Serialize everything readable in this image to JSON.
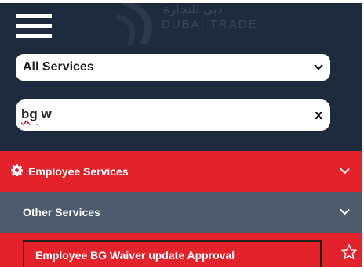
{
  "header": {
    "menu_icon": "hamburger-menu-icon",
    "logo_arabic": "دبي للتجارة",
    "logo_text": "DUBAI TRADE"
  },
  "filters": {
    "category_select": {
      "selected": "All Services",
      "icon": "chevron-down-icon"
    },
    "search": {
      "value_word1": "bg",
      "value_word2": " w",
      "clear_label": "x"
    }
  },
  "menu": {
    "employee_services": {
      "label": "Employee Services",
      "icon": "gear-icon",
      "expand_icon": "chevron-down-icon"
    },
    "other_services": {
      "label": "Other Services",
      "expand_icon": "chevron-down-icon"
    },
    "results": [
      {
        "label": "Employee BG Waiver update Approval",
        "favorite_icon": "star-outline-icon"
      }
    ]
  },
  "colors": {
    "frame": "#1e2a3d",
    "accent_red": "#e3222b",
    "section_grey": "#4c5a6c",
    "text_white": "#ffffff"
  }
}
